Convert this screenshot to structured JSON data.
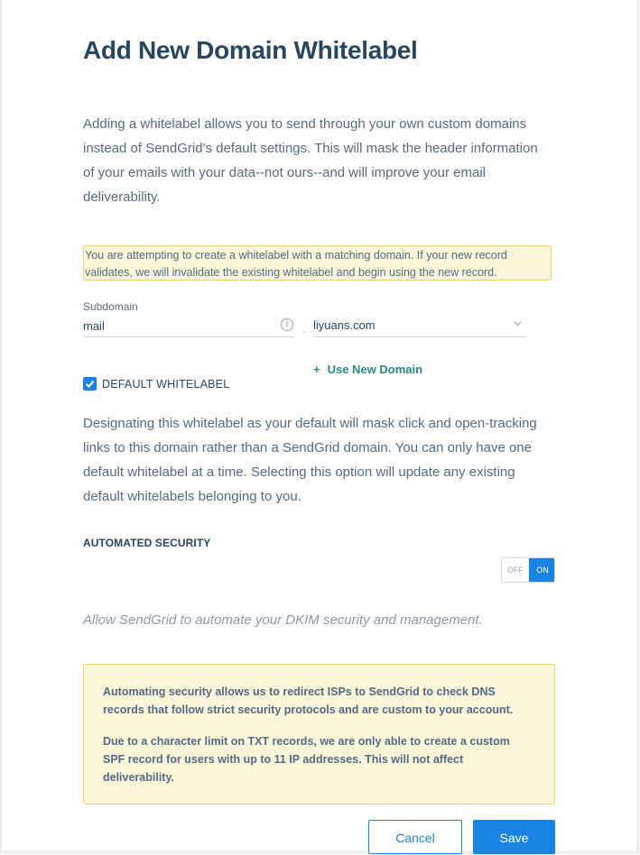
{
  "modal": {
    "title": "Add New Domain Whitelabel",
    "intro": "Adding a whitelabel allows you to send through your own custom domains instead of SendGrid's default settings. This will mask the header information of your emails with your data--not ours--and will improve your email deliverability.",
    "warning": "You are attempting to create a whitelabel with a matching domain. If your new record validates, we will invalidate the existing whitelabel and begin using the new record."
  },
  "form": {
    "subdomain_label": "Subdomain",
    "subdomain_value": "mail",
    "separator": ".",
    "domain_value": "liyuans.com",
    "use_new_domain_plus": "+",
    "use_new_domain": "Use New Domain",
    "default_whitelabel_label": "DEFAULT WHITELABEL",
    "default_whitelabel_checked": true,
    "default_desc": "Designating this whitelabel as your default will mask click and open-tracking links to this domain rather than a SendGrid domain. You can only have one default whitelabel at a time. Selecting this option will update any existing default whitelabels belonging to you."
  },
  "security": {
    "title": "AUTOMATED SECURITY",
    "toggle_off": "OFF",
    "toggle_on": "ON",
    "toggle_state": "on",
    "description": "Allow SendGrid to automate your DKIM security and management.",
    "note_p1": "Automating security allows us to redirect ISPs to SendGrid to check DNS records that follow strict security protocols and are custom to your account.",
    "note_p2": "Due to a character limit on TXT records, we are only able to create a custom SPF record for users with up to 11 IP addresses. This will not affect deliverability."
  },
  "buttons": {
    "cancel": "Cancel",
    "save": "Save"
  },
  "colors": {
    "primary": "#1a82e2",
    "heading": "#294661",
    "body_text": "#546b81",
    "accent_link": "#2b8586",
    "warning_bg": "#fbf6d9",
    "warning_border": "#e8d36d"
  },
  "icons": {
    "info": "info-circle-icon",
    "chevron": "chevron-down-icon",
    "check": "check-icon"
  }
}
